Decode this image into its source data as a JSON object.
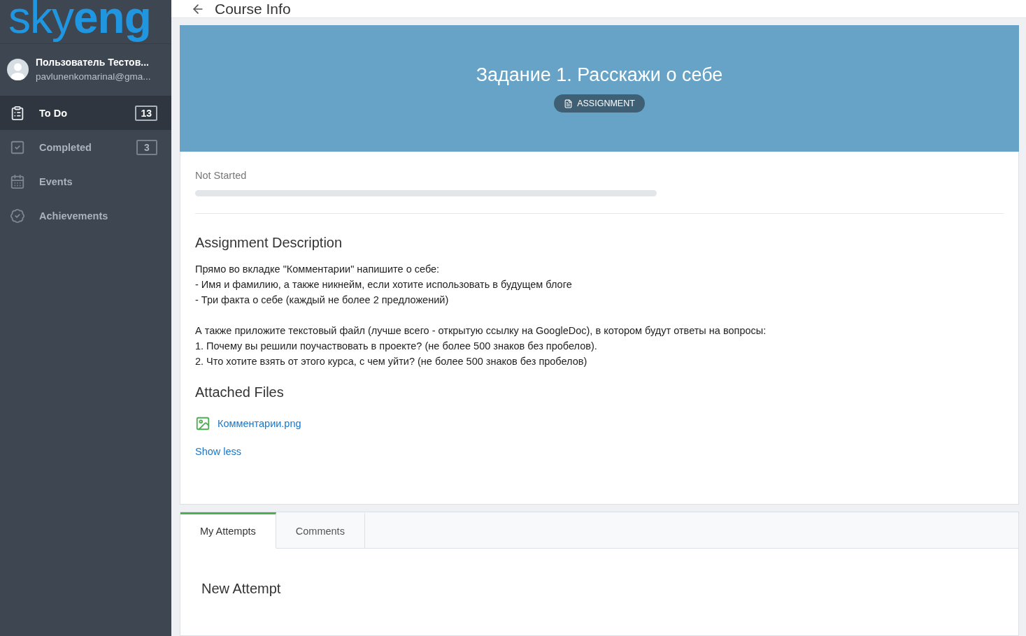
{
  "sidebar": {
    "logo": {
      "light": "sky",
      "bold": "eng"
    },
    "user": {
      "name": "Пользователь Тестов...",
      "email": "pavlunenkomarinal@gma..."
    },
    "items": [
      {
        "kind": "todo",
        "label": "To Do",
        "count": "13",
        "selected": true
      },
      {
        "kind": "completed",
        "label": "Completed",
        "count": "3",
        "selected": false
      },
      {
        "kind": "events",
        "label": "Events",
        "selected": false
      },
      {
        "kind": "achievements",
        "label": "Achievements",
        "selected": false
      }
    ]
  },
  "header": {
    "title": "Course Info"
  },
  "banner": {
    "title": "Задание 1. Расскажи о себе",
    "badge": "ASSIGNMENT"
  },
  "progress": {
    "label": "Not Started",
    "level": 0
  },
  "description": {
    "heading": "Assignment Description",
    "paragraphs": [
      [
        "Прямо во вкладке \"Комментарии\" напишите о себе:",
        "- Имя и фамилию, а также никнейм, если хотите использовать в будущем блоге",
        "- Три факта о себе (каждый не более 2 предложений)"
      ],
      [
        "А также приложите текстовый файл (лучше всего - открытую ссылку на GoogleDoc), в котором будут ответы на вопросы:",
        "1. Почему вы решили поучаствовать в проекте? (не более 500 знаков без пробелов).",
        "2. Что хотите взять от этого курса, с чем уйти? (не более 500 знаков без пробелов)"
      ]
    ]
  },
  "attachments": {
    "heading": "Attached Files",
    "files": [
      "Комментарии.png"
    ],
    "toggle": "Show less"
  },
  "tabs": [
    {
      "label": "My Attempts",
      "selected": true
    },
    {
      "label": "Comments",
      "selected": false
    }
  ],
  "attempt": {
    "heading": "New Attempt"
  }
}
